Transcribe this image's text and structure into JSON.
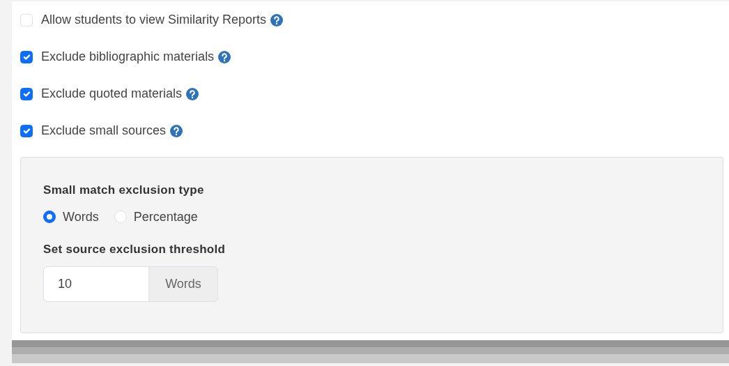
{
  "options": [
    {
      "label": "Allow students to view Similarity Reports",
      "checked": false
    },
    {
      "label": "Exclude bibliographic materials",
      "checked": true
    },
    {
      "label": "Exclude quoted materials",
      "checked": true
    },
    {
      "label": "Exclude small sources",
      "checked": true
    }
  ],
  "small_sources_panel": {
    "exclusion_type_heading": "Small match exclusion type",
    "exclusion_types": [
      {
        "label": "Words",
        "selected": true
      },
      {
        "label": "Percentage",
        "selected": false
      }
    ],
    "threshold_heading": "Set source exclusion threshold",
    "threshold": {
      "value": "10",
      "unit": "Words"
    }
  }
}
